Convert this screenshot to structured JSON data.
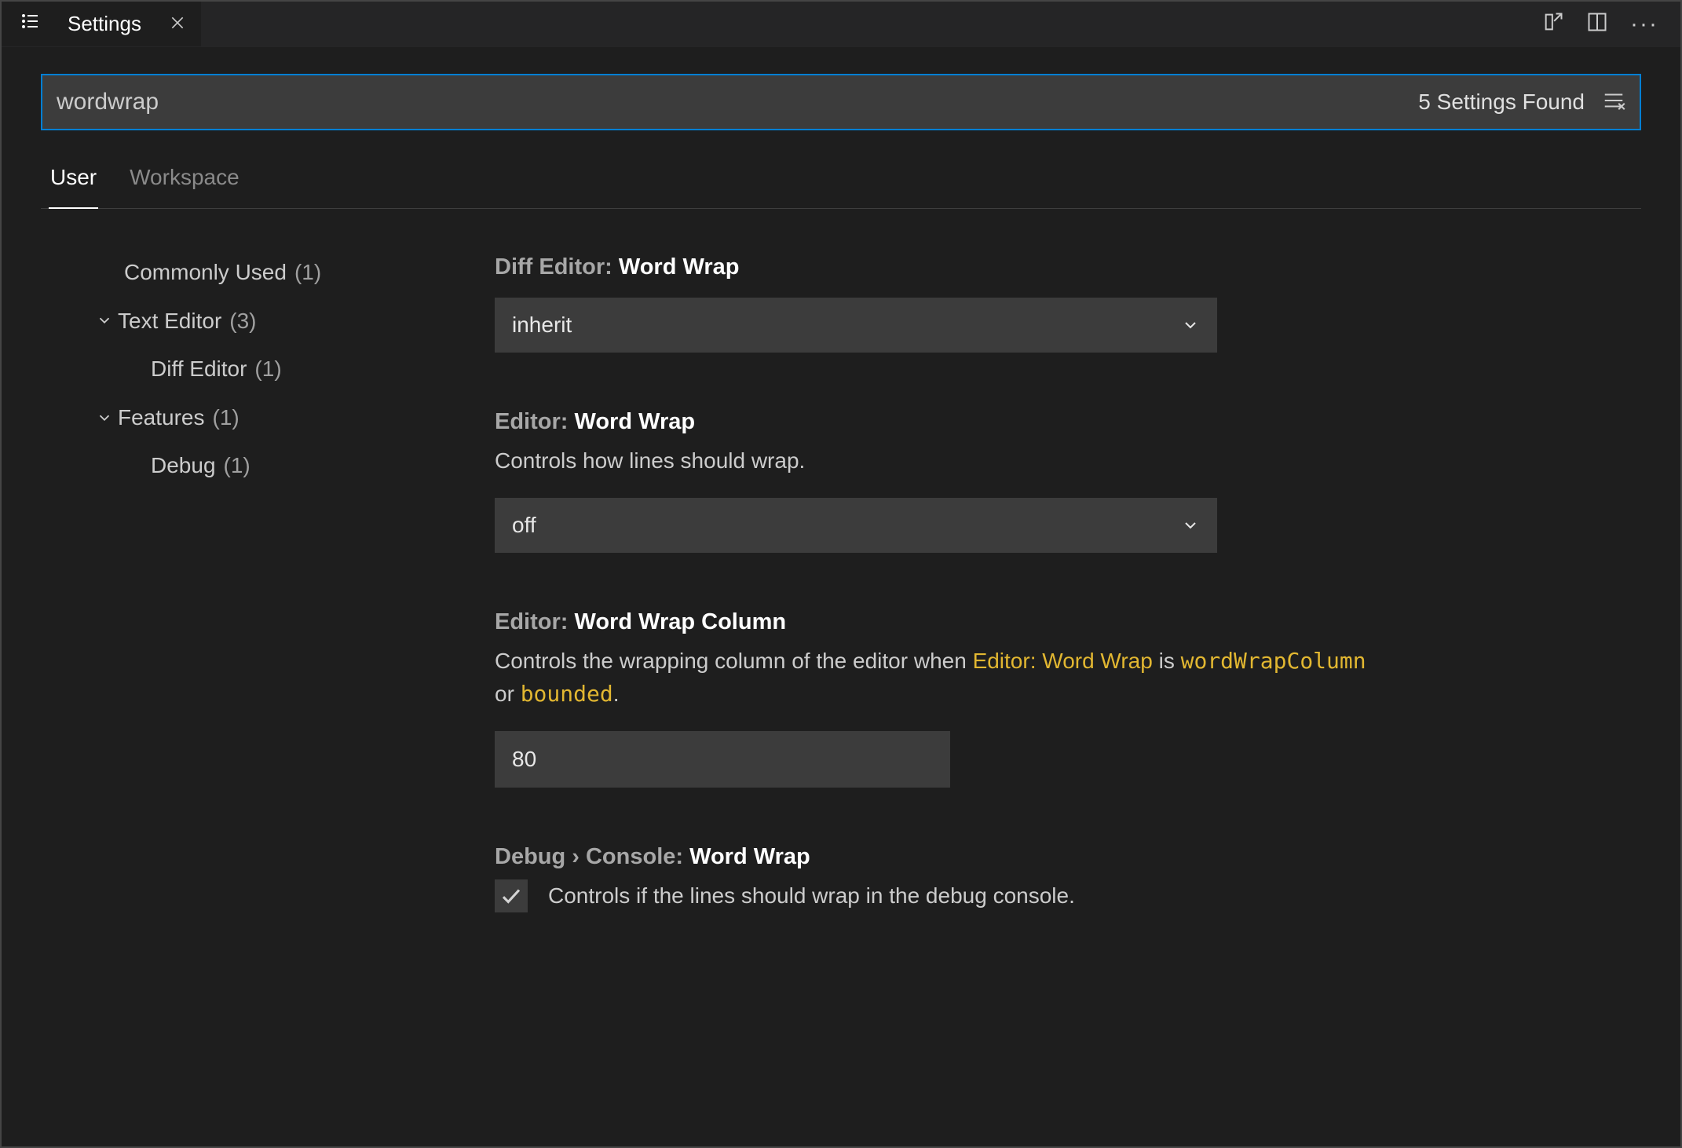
{
  "tab": {
    "title": "Settings"
  },
  "search": {
    "value": "wordwrap",
    "results_text": "5 Settings Found"
  },
  "scope": {
    "user": "User",
    "workspace": "Workspace"
  },
  "tree": {
    "commonly_used": {
      "label": "Commonly Used",
      "count": "(1)"
    },
    "text_editor": {
      "label": "Text Editor",
      "count": "(3)"
    },
    "diff_editor": {
      "label": "Diff Editor",
      "count": "(1)"
    },
    "features": {
      "label": "Features",
      "count": "(1)"
    },
    "debug": {
      "label": "Debug",
      "count": "(1)"
    }
  },
  "settings": {
    "diff_wordwrap": {
      "scope": "Diff Editor: ",
      "name": "Word Wrap",
      "value": "inherit"
    },
    "editor_wordwrap": {
      "scope": "Editor: ",
      "name": "Word Wrap",
      "desc": "Controls how lines should wrap.",
      "value": "off"
    },
    "editor_wordwrap_column": {
      "scope": "Editor: ",
      "name": "Word Wrap Column",
      "desc_pre": "Controls the wrapping column of the editor when ",
      "desc_link": "Editor: Word Wrap",
      "desc_mid": " is ",
      "desc_code1": "wordWrapColumn",
      "desc_or": " or ",
      "desc_code2": "bounded",
      "desc_end": ".",
      "value": "80"
    },
    "debug_console_wordwrap": {
      "scope": "Debug › Console: ",
      "name": "Word Wrap",
      "desc": "Controls if the lines should wrap in the debug console."
    }
  }
}
